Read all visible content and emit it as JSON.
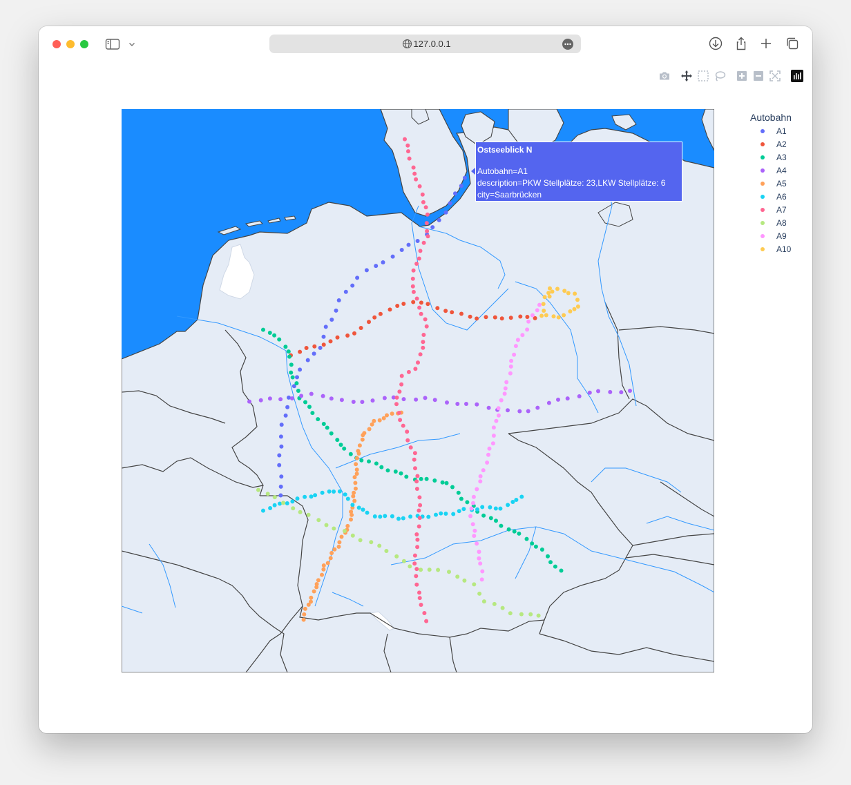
{
  "browser": {
    "url": "127.0.0.1"
  },
  "legend": {
    "title": "Autobahn",
    "items": [
      {
        "name": "A1",
        "color": "#636efa"
      },
      {
        "name": "A2",
        "color": "#ef553b"
      },
      {
        "name": "A3",
        "color": "#00cc96"
      },
      {
        "name": "A4",
        "color": "#ab63fa"
      },
      {
        "name": "A5",
        "color": "#ffa15a"
      },
      {
        "name": "A6",
        "color": "#19d3f3"
      },
      {
        "name": "A7",
        "color": "#ff6692"
      },
      {
        "name": "A8",
        "color": "#b6e880"
      },
      {
        "name": "A9",
        "color": "#ff97ff"
      },
      {
        "name": "A10",
        "color": "#fecb52"
      }
    ]
  },
  "tooltip": {
    "title": "Ostseeblick N",
    "autobahn": "Autobahn=A1",
    "description": "description=PKW Stellplätze: 23,LKW Stellplätze: 6",
    "city": "city=Saarbrücken"
  },
  "map_colors": {
    "ocean": "#1a8cff",
    "land": "#e5ecf6",
    "border": "#444444",
    "river": "#3399ff"
  },
  "modebar": [
    "camera-icon",
    "pan-icon",
    "box-select-icon",
    "lasso-icon",
    "zoom-in-icon",
    "zoom-out-icon",
    "reset-icon",
    "plotly-logo-icon"
  ]
}
